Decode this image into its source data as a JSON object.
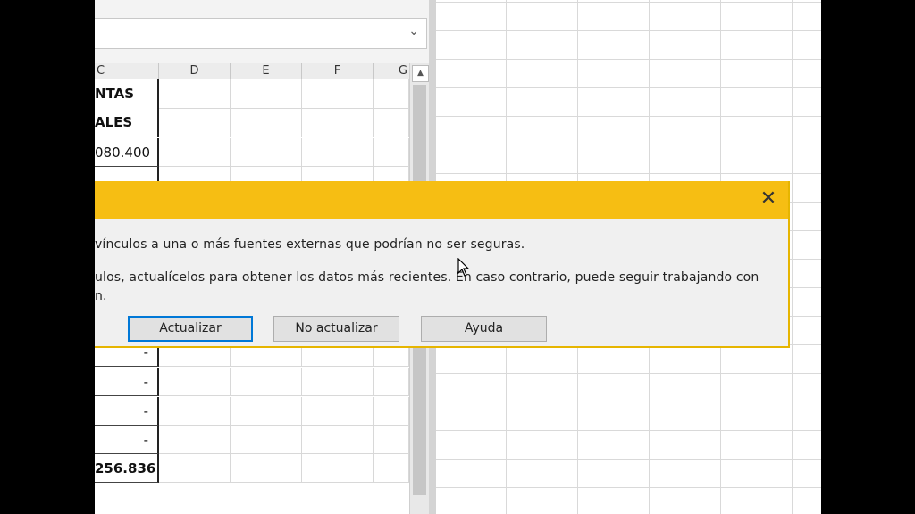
{
  "formula_bar": {
    "namebox_arrow": "⌄"
  },
  "sheet": {
    "columns": [
      "C",
      "D",
      "E",
      "F",
      "G"
    ],
    "column_c": [
      {
        "text": "NTAS",
        "style": "hdr"
      },
      {
        "text": "ALES",
        "style": "hdr"
      },
      {
        "text": "080.400",
        "style": "normal"
      },
      {
        "text": "",
        "style": "normal"
      },
      {
        "text": "",
        "style": "normal"
      },
      {
        "text": "",
        "style": "normal"
      },
      {
        "text": "",
        "style": "normal"
      },
      {
        "text": "",
        "style": "normal"
      },
      {
        "text": "",
        "style": "normal"
      },
      {
        "text": "-",
        "style": "normal"
      },
      {
        "text": "-",
        "style": "normal"
      },
      {
        "text": "-",
        "style": "normal"
      },
      {
        "text": "-",
        "style": "normal"
      },
      {
        "text": "256.836",
        "style": "bold"
      }
    ]
  },
  "scrollbar": {
    "up_arrow": "▲"
  },
  "dialog": {
    "close_glyph": "✕",
    "line1": "vínculos a una o más fuentes externas que podrían no ser seguras.",
    "line2": "ulos, actualícelos para obtener los datos más recientes. En caso contrario, puede seguir trabajando con",
    "line3": "n.",
    "buttons": {
      "update": "Actualizar",
      "no_update": "No actualizar",
      "help": "Ayuda"
    },
    "colors": {
      "titlebar": "#f6be13",
      "default_button_border": "#0078d7"
    }
  }
}
